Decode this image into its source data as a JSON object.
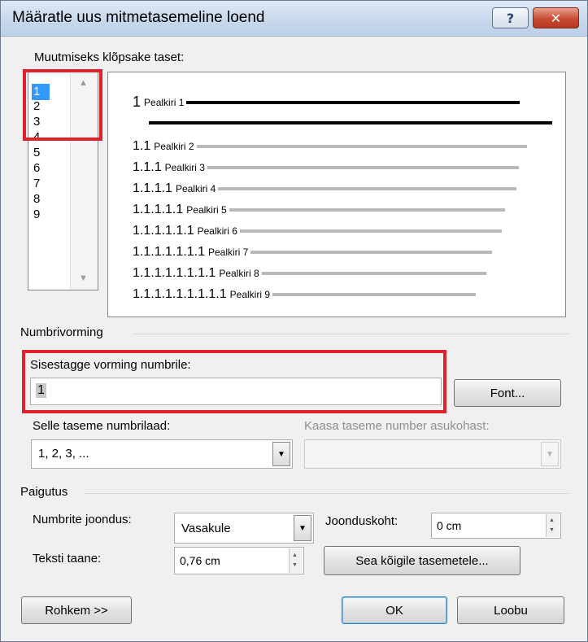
{
  "window": {
    "title": "Määratle uus mitmetasemeline loend",
    "help_label": "?",
    "close_label": "✕"
  },
  "levels": {
    "label": "Muutmiseks klõpsake taset:",
    "items": [
      "1",
      "2",
      "3",
      "4",
      "5",
      "6",
      "7",
      "8",
      "9"
    ],
    "selected": "1"
  },
  "preview": {
    "rows": [
      {
        "num": "1",
        "name": "Pealkiri 1"
      },
      {
        "num": "1.1",
        "name": "Pealkiri 2"
      },
      {
        "num": "1.1.1",
        "name": "Pealkiri 3"
      },
      {
        "num": "1.1.1.1",
        "name": "Pealkiri 4"
      },
      {
        "num": "1.1.1.1.1",
        "name": "Pealkiri 5"
      },
      {
        "num": "1.1.1.1.1.1",
        "name": "Pealkiri 6"
      },
      {
        "num": "1.1.1.1.1.1.1",
        "name": "Pealkiri 7"
      },
      {
        "num": "1.1.1.1.1.1.1.1",
        "name": "Pealkiri 8"
      },
      {
        "num": "1.1.1.1.1.1.1.1.1",
        "name": "Pealkiri 9"
      }
    ]
  },
  "number_format": {
    "section_label": "Numbrivorming",
    "format_label": "Sisestagge vorming numbrile:",
    "format_value": "1",
    "font_button": "Font...",
    "style_label": "Selle taseme numbrilaad:",
    "style_value": "1, 2, 3, ...",
    "include_label": "Kaasa taseme number asukohast:",
    "include_value": ""
  },
  "position": {
    "section_label": "Paigutus",
    "alignment_label": "Numbrite joondus:",
    "alignment_value": "Vasakule",
    "aligned_at_label": "Joonduskoht:",
    "aligned_at_value": "0 cm",
    "indent_label": "Teksti taane:",
    "indent_value": "0,76 cm",
    "set_all_button": "Sea kõigile tasemetele..."
  },
  "footer": {
    "more_button": "Rohkem >>",
    "ok_button": "OK",
    "cancel_button": "Loobu"
  }
}
